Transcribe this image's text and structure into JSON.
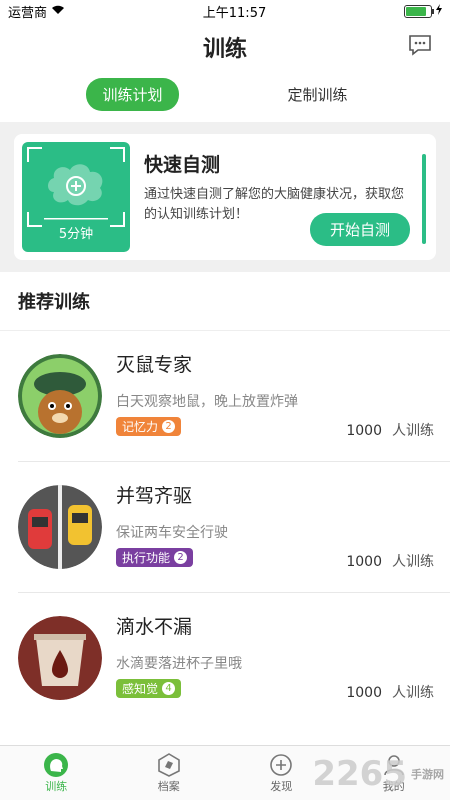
{
  "status": {
    "carrier": "运营商",
    "time": "上午11:57"
  },
  "header": {
    "title": "训练"
  },
  "tabs": [
    {
      "label": "训练计划"
    },
    {
      "label": "定制训练"
    }
  ],
  "quick_test": {
    "duration": "5分钟",
    "title": "快速自测",
    "description": "通过快速自测了解您的大脑健康状况，获取您的认知训练计划！",
    "button": "开始自测"
  },
  "recommend": {
    "title": "推荐训练",
    "items": [
      {
        "name": "灭鼠专家",
        "desc": "白天观察地鼠，晚上放置炸弹",
        "tag": "记忆力",
        "level": "2",
        "count": "1000",
        "unit": "人训练",
        "tag_color": "#f0843a"
      },
      {
        "name": "并驾齐驱",
        "desc": "保证两车安全行驶",
        "tag": "执行功能",
        "level": "2",
        "count": "1000",
        "unit": "人训练",
        "tag_color": "#7a3fa0"
      },
      {
        "name": "滴水不漏",
        "desc": "水滴要落进杯子里哦",
        "tag": "感知觉",
        "level": "4",
        "count": "1000",
        "unit": "人训练",
        "tag_color": "#7bbf3a"
      }
    ]
  },
  "bottom_nav": [
    {
      "label": "训练"
    },
    {
      "label": "档案"
    },
    {
      "label": "发现"
    },
    {
      "label": "我的"
    }
  ],
  "watermark": {
    "text": "2265",
    "sub": "手游网"
  }
}
